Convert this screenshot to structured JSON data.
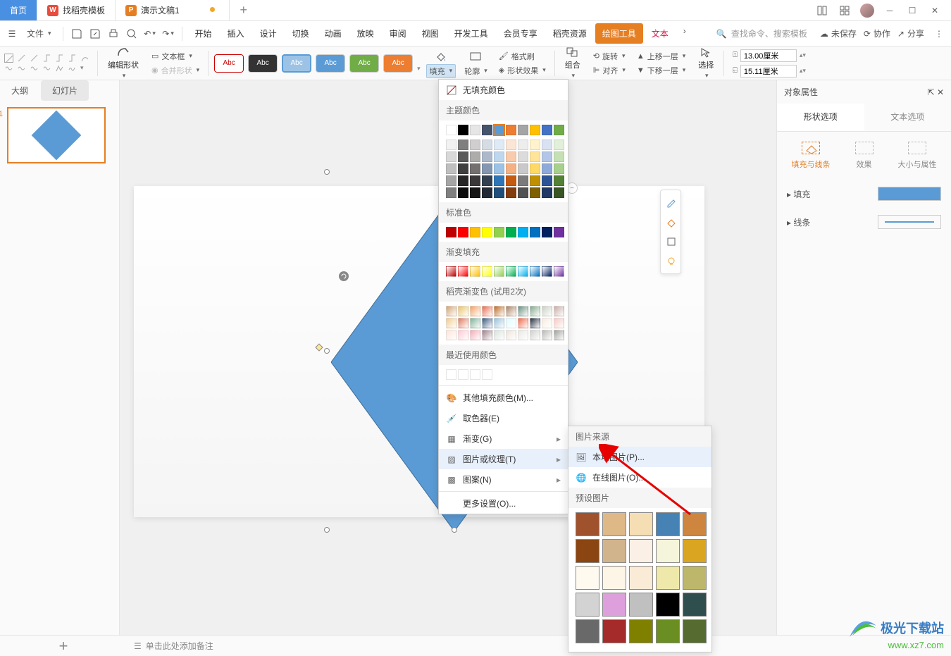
{
  "titlebar": {
    "tabs": [
      {
        "label": "首页",
        "icon": ""
      },
      {
        "label": "找稻壳模板",
        "icon": "W"
      },
      {
        "label": "演示文稿1",
        "icon": "P"
      }
    ],
    "newtab": "+"
  },
  "menubar": {
    "file": "文件",
    "tabs": [
      "开始",
      "插入",
      "设计",
      "切换",
      "动画",
      "放映",
      "审阅",
      "视图",
      "开发工具",
      "会员专享",
      "稻壳资源",
      "绘图工具",
      "文本"
    ],
    "search_placeholder": "查找命令、搜索模板",
    "unsaved": "未保存",
    "coop": "协作",
    "share": "分享"
  },
  "ribbon": {
    "edit_shape": "编辑形状",
    "merge_shape": "合并形状",
    "text_box": "文本框",
    "abc": "Abc",
    "fill": "填充",
    "outline": "轮廓",
    "format_painter": "格式刷",
    "shape_effects": "形状效果",
    "group": "组合",
    "rotate": "旋转",
    "align": "对齐",
    "up_layer": "上移一层",
    "down_layer": "下移一层",
    "select": "选择",
    "height_icon": "高",
    "width_icon": "宽",
    "height": "13.00厘米",
    "width": "15.11厘米"
  },
  "leftpanel": {
    "outline": "大纲",
    "slides": "幻灯片",
    "slide_num": "1"
  },
  "fill_dropdown": {
    "no_fill": "无填充颜色",
    "theme_colors": "主题颜色",
    "standard_colors": "标准色",
    "gradient_fill": "渐变填充",
    "docer_gradient": "稻壳渐变色 (试用2次)",
    "recent": "最近使用颜色",
    "other_fill": "其他填充颜色(M)...",
    "eyedropper": "取色器(E)",
    "gradient": "渐变(G)",
    "picture_texture": "图片或纹理(T)",
    "pattern": "图案(N)",
    "more_settings": "更多设置(O)..."
  },
  "pic_submenu": {
    "source": "图片来源",
    "local": "本地图片(P)...",
    "online": "在线图片(O)...",
    "preset": "预设图片"
  },
  "rightpanel": {
    "title": "对象属性",
    "shape_options": "形状选项",
    "text_options": "文本选项",
    "fill_line": "填充与线条",
    "effects": "效果",
    "size_props": "大小与属性",
    "fill": "填充",
    "line": "线条"
  },
  "statusbar": {
    "add_notes": "单击此处添加备注"
  },
  "watermark": {
    "name": "极光下载站",
    "url": "www.xz7.com"
  },
  "colors": {
    "theme_row1": [
      "#ffffff",
      "#000000",
      "#e7e6e6",
      "#44546a",
      "#5b9bd5",
      "#ed7d31",
      "#a5a5a5",
      "#ffc000",
      "#4472c4",
      "#70ad47"
    ],
    "theme_shades": [
      [
        "#f2f2f2",
        "#7f7f7f",
        "#d0cece",
        "#d6dce4",
        "#deebf6",
        "#fbe5d5",
        "#ededed",
        "#fff2cc",
        "#d9e2f3",
        "#e2efd9"
      ],
      [
        "#d8d8d8",
        "#595959",
        "#aeabab",
        "#adb9ca",
        "#bdd7ee",
        "#f7cbac",
        "#dbdbdb",
        "#fee599",
        "#b4c6e7",
        "#c5e0b3"
      ],
      [
        "#bfbfbf",
        "#3f3f3f",
        "#757070",
        "#8496b0",
        "#9cc3e5",
        "#f4b183",
        "#c9c9c9",
        "#ffd965",
        "#8eaadb",
        "#a8d08d"
      ],
      [
        "#a5a5a5",
        "#262626",
        "#3a3838",
        "#323f4f",
        "#2e75b5",
        "#c55a11",
        "#7b7b7b",
        "#bf9000",
        "#2f5496",
        "#538135"
      ],
      [
        "#7f7f7f",
        "#0c0c0c",
        "#171616",
        "#222a35",
        "#1e4e79",
        "#833c0b",
        "#525252",
        "#7f6000",
        "#1f3864",
        "#375623"
      ]
    ],
    "standard": [
      "#c00000",
      "#ff0000",
      "#ffc000",
      "#ffff00",
      "#92d050",
      "#00b050",
      "#00b0f0",
      "#0070c0",
      "#002060",
      "#7030a0"
    ],
    "gradient": [
      "#c00000",
      "#ff0000",
      "#ffc000",
      "#ffff00",
      "#92d050",
      "#00b050",
      "#00b0f0",
      "#0070c0",
      "#002060",
      "#7030a0"
    ],
    "docer1": [
      "#d4a373",
      "#e9c46a",
      "#f4a261",
      "#e76f51",
      "#bc6c25",
      "#a98467",
      "#6b9080",
      "#84a98c",
      "#cad2c5",
      "#c9ada7"
    ],
    "docer2": [
      "#f2cc8f",
      "#e07a5f",
      "#81b29a",
      "#3d5a80",
      "#98c1d9",
      "#e0fbfc",
      "#ee6c4d",
      "#293241",
      "#f7ede2",
      "#f5cac3"
    ],
    "docer3": [
      "#ffe5d9",
      "#ffcad4",
      "#f4acb7",
      "#9d8189",
      "#d8e2dc",
      "#ece4db",
      "#e8e8e4",
      "#d0d0ce",
      "#b8b8b4",
      "#a0a09c"
    ],
    "recent": [
      "#ffffff",
      "#ffffff",
      "#ffffff",
      "#ffffff"
    ],
    "textures": [
      "#a0522d",
      "#deb887",
      "#f5deb3",
      "#4682b4",
      "#cd853f",
      "#8b4513",
      "#d2b48c",
      "#faf0e6",
      "#f5f5dc",
      "#daa520",
      "#fffaf0",
      "#fdf5e6",
      "#faebd7",
      "#eee8aa",
      "#bdb76b",
      "#d3d3d3",
      "#dda0dd",
      "#c0c0c0",
      "#000000",
      "#2f4f4f",
      "#696969",
      "#a52a2a",
      "#808000",
      "#6b8e23",
      "#556b2f"
    ]
  }
}
